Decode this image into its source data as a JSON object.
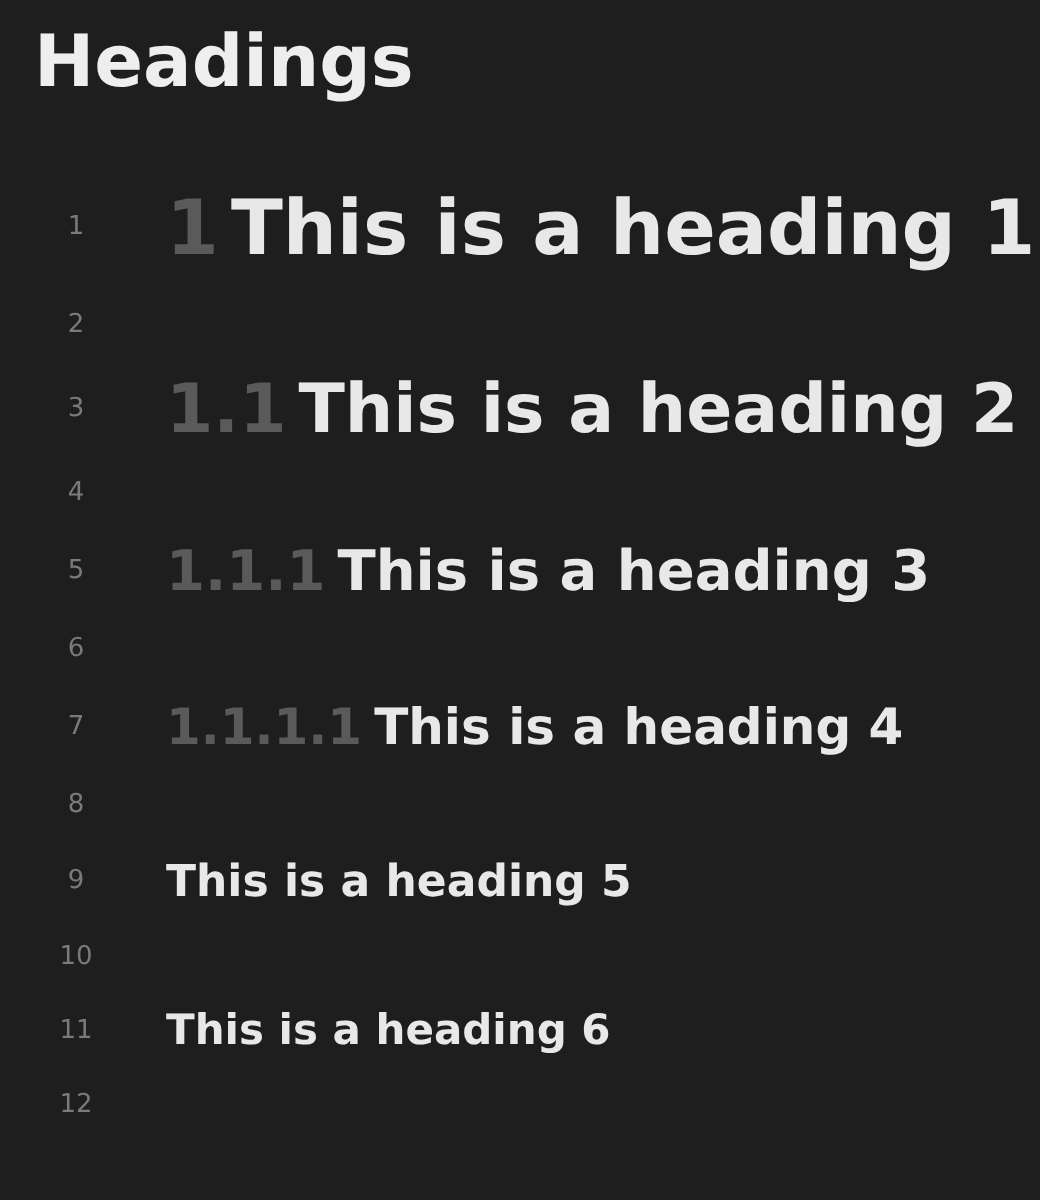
{
  "title": "Headings",
  "lines": [
    {
      "number": "1",
      "kind": "h1",
      "prefix": "1",
      "text": "This is a heading 1"
    },
    {
      "number": "2",
      "kind": "blank"
    },
    {
      "number": "3",
      "kind": "h2",
      "prefix": "1.1",
      "text": "This is a heading 2"
    },
    {
      "number": "4",
      "kind": "blank"
    },
    {
      "number": "5",
      "kind": "h3",
      "prefix": "1.1.1",
      "text": "This is a heading 3"
    },
    {
      "number": "6",
      "kind": "blank"
    },
    {
      "number": "7",
      "kind": "h4",
      "prefix": "1.1.1.1",
      "text": "This is a heading 4"
    },
    {
      "number": "8",
      "kind": "blank"
    },
    {
      "number": "9",
      "kind": "h5",
      "text": "This is a heading 5"
    },
    {
      "number": "10",
      "kind": "blank"
    },
    {
      "number": "11",
      "kind": "h6",
      "text": "This is a heading 6"
    },
    {
      "number": "12",
      "kind": "blank"
    }
  ]
}
